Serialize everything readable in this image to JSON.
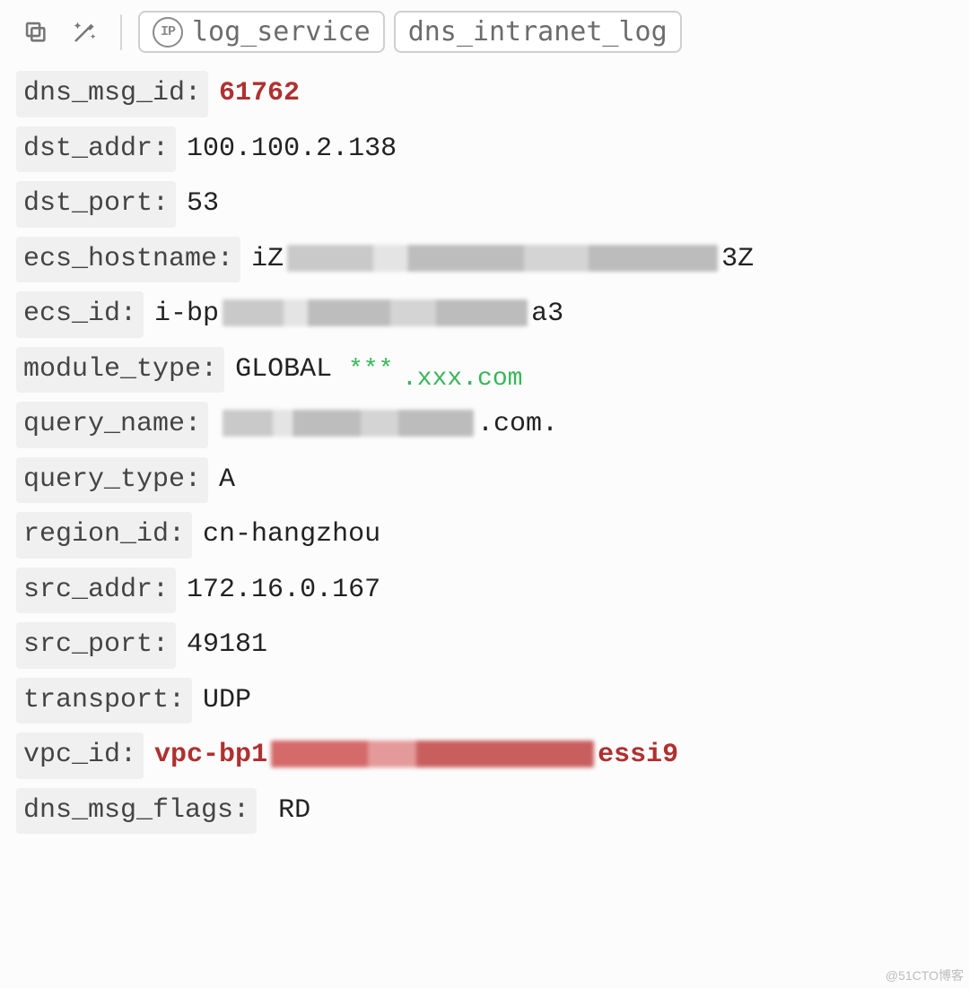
{
  "toolbar": {
    "copy_icon": "copy-icon",
    "magic_icon": "magic-wand-icon",
    "ip_badge": "IP",
    "chip_logservice": "log_service",
    "chip_dnslog": "dns_intranet_log"
  },
  "fields": {
    "dns_msg_id": {
      "key": "dns_msg_id",
      "value": "61762"
    },
    "dst_addr": {
      "key": "dst_addr",
      "value": "100.100.2.138"
    },
    "dst_port": {
      "key": "dst_port",
      "value": "53"
    },
    "ecs_hostname": {
      "key": "ecs_hostname",
      "prefix": "iZ",
      "suffix": "3Z"
    },
    "ecs_id": {
      "key": "ecs_id",
      "prefix": "i-bp",
      "suffix": "a3"
    },
    "module_type": {
      "key": "module_type",
      "value": "GLOBAL",
      "green_stars": "***",
      "green_text": ".xxx.com"
    },
    "query_name": {
      "key": "query_name",
      "suffix": ".com."
    },
    "query_type": {
      "key": "query_type",
      "value": "A"
    },
    "region_id": {
      "key": "region_id",
      "value": "cn-hangzhou"
    },
    "src_addr": {
      "key": "src_addr",
      "value": "172.16.0.167"
    },
    "src_port": {
      "key": "src_port",
      "value": "49181"
    },
    "transport": {
      "key": "transport",
      "value": "UDP"
    },
    "vpc_id": {
      "key": "vpc_id",
      "prefix": "vpc-bp1",
      "suffix": "essi9"
    },
    "dns_msg_flags": {
      "key": "dns_msg_flags",
      "value": "RD"
    }
  },
  "watermark": "@51CTO博客"
}
